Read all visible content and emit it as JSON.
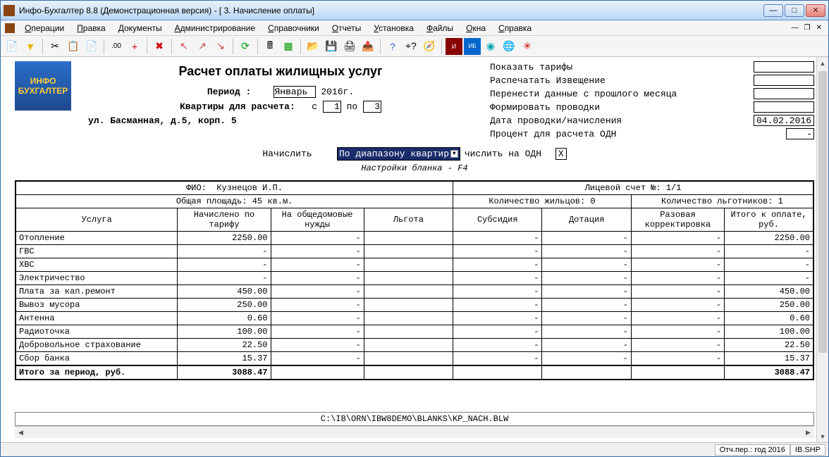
{
  "window": {
    "title": "Инфо-Бухгалтер 8.8 (Демонстрационная версия) - [   3. Начисление оплаты]"
  },
  "menu": {
    "items": [
      "Операции",
      "Правка",
      "Документы",
      "Администрирование",
      "Справочники",
      "Отчеты",
      "Установка",
      "Файлы",
      "Окна",
      "Справка"
    ]
  },
  "logo": {
    "line1": "ИНФО",
    "line2": "БУХГАЛТЕР"
  },
  "doc": {
    "title": "Расчет оплаты жилищных услуг",
    "period_label": "Период :",
    "month": "Январь",
    "year": "2016г.",
    "apts_label": "Квартиры для расчета:",
    "from_label": "с",
    "from_val": "1",
    "to_label": "по",
    "to_val": "3",
    "address": "ул. Басманная, д.5, корп. 5",
    "calc_label": "Начислить",
    "dropdown_val": "По диапазону квартир",
    "odn_label": "числить на ОДН",
    "odn_val": "Х",
    "settings_hint": "Настройки бланка - F4"
  },
  "right": {
    "r1": "Показать тарифы",
    "r2": "Распечатать Извещение",
    "r3": "Перенести данные с прошлого месяца",
    "r4": "Формировать проводки",
    "r5": "Дата проводки/начисления",
    "r5v": "04.02.2016",
    "r6": "Процент для расчета ОДН",
    "r6v": "-"
  },
  "grid": {
    "fio_lbl": "ФИО:",
    "fio_val": "Кузнецов И.П.",
    "account_lbl": "Лицевой счет №:",
    "account_val": "1/1",
    "area_lbl": "Общая площадь:",
    "area_val": "45 кв.м.",
    "residents_lbl": "Количество жильцов:",
    "residents_val": "0",
    "beneficiaries_lbl": "Количество льготников:",
    "beneficiaries_val": "1",
    "cols": [
      "Услуга",
      "Начислено по тарифу",
      "На общедомовые нужды",
      "Льгота",
      "Субсидия",
      "Дотация",
      "Разовая корректировка",
      "Итого к оплате, руб."
    ],
    "rows": [
      {
        "s": "Отопление",
        "v": [
          "2250.00",
          "-",
          "",
          "-",
          "-",
          "-",
          "2250.00"
        ]
      },
      {
        "s": "ГВС",
        "v": [
          "-",
          "-",
          "",
          "-",
          "-",
          "-",
          "-"
        ]
      },
      {
        "s": "ХВС",
        "v": [
          "-",
          "-",
          "",
          "-",
          "-",
          "-",
          "-"
        ]
      },
      {
        "s": "Электричество",
        "v": [
          "-",
          "-",
          "",
          "-",
          "-",
          "-",
          "-"
        ]
      },
      {
        "s": "Плата за кап.ремонт",
        "v": [
          "450.00",
          "-",
          "",
          "-",
          "-",
          "-",
          "450.00"
        ]
      },
      {
        "s": "Вывоз мусора",
        "v": [
          "250.00",
          "-",
          "",
          "-",
          "-",
          "-",
          "250.00"
        ]
      },
      {
        "s": "Антенна",
        "v": [
          "0.60",
          "-",
          "",
          "-",
          "-",
          "-",
          "0.60"
        ]
      },
      {
        "s": "Радиоточка",
        "v": [
          "100.00",
          "-",
          "",
          "-",
          "-",
          "-",
          "100.00"
        ]
      },
      {
        "s": "Добровольное страхование",
        "v": [
          "22.50",
          "-",
          "",
          "-",
          "-",
          "-",
          "22.50"
        ]
      },
      {
        "s": "Сбор банка",
        "v": [
          "15.37",
          "-",
          "",
          "-",
          "-",
          "-",
          "15.37"
        ]
      }
    ],
    "total_label": "Итого за период, руб.",
    "total": [
      "3088.47",
      "",
      "",
      "",
      "",
      "",
      "3088.47"
    ]
  },
  "filepath": "C:\\IB\\ORN\\IBW8DEMO\\BLANKS\\KP_NACH.BLW",
  "status": {
    "p1": "Отч.пер.: год 2016",
    "p2": "IB.SHP"
  }
}
